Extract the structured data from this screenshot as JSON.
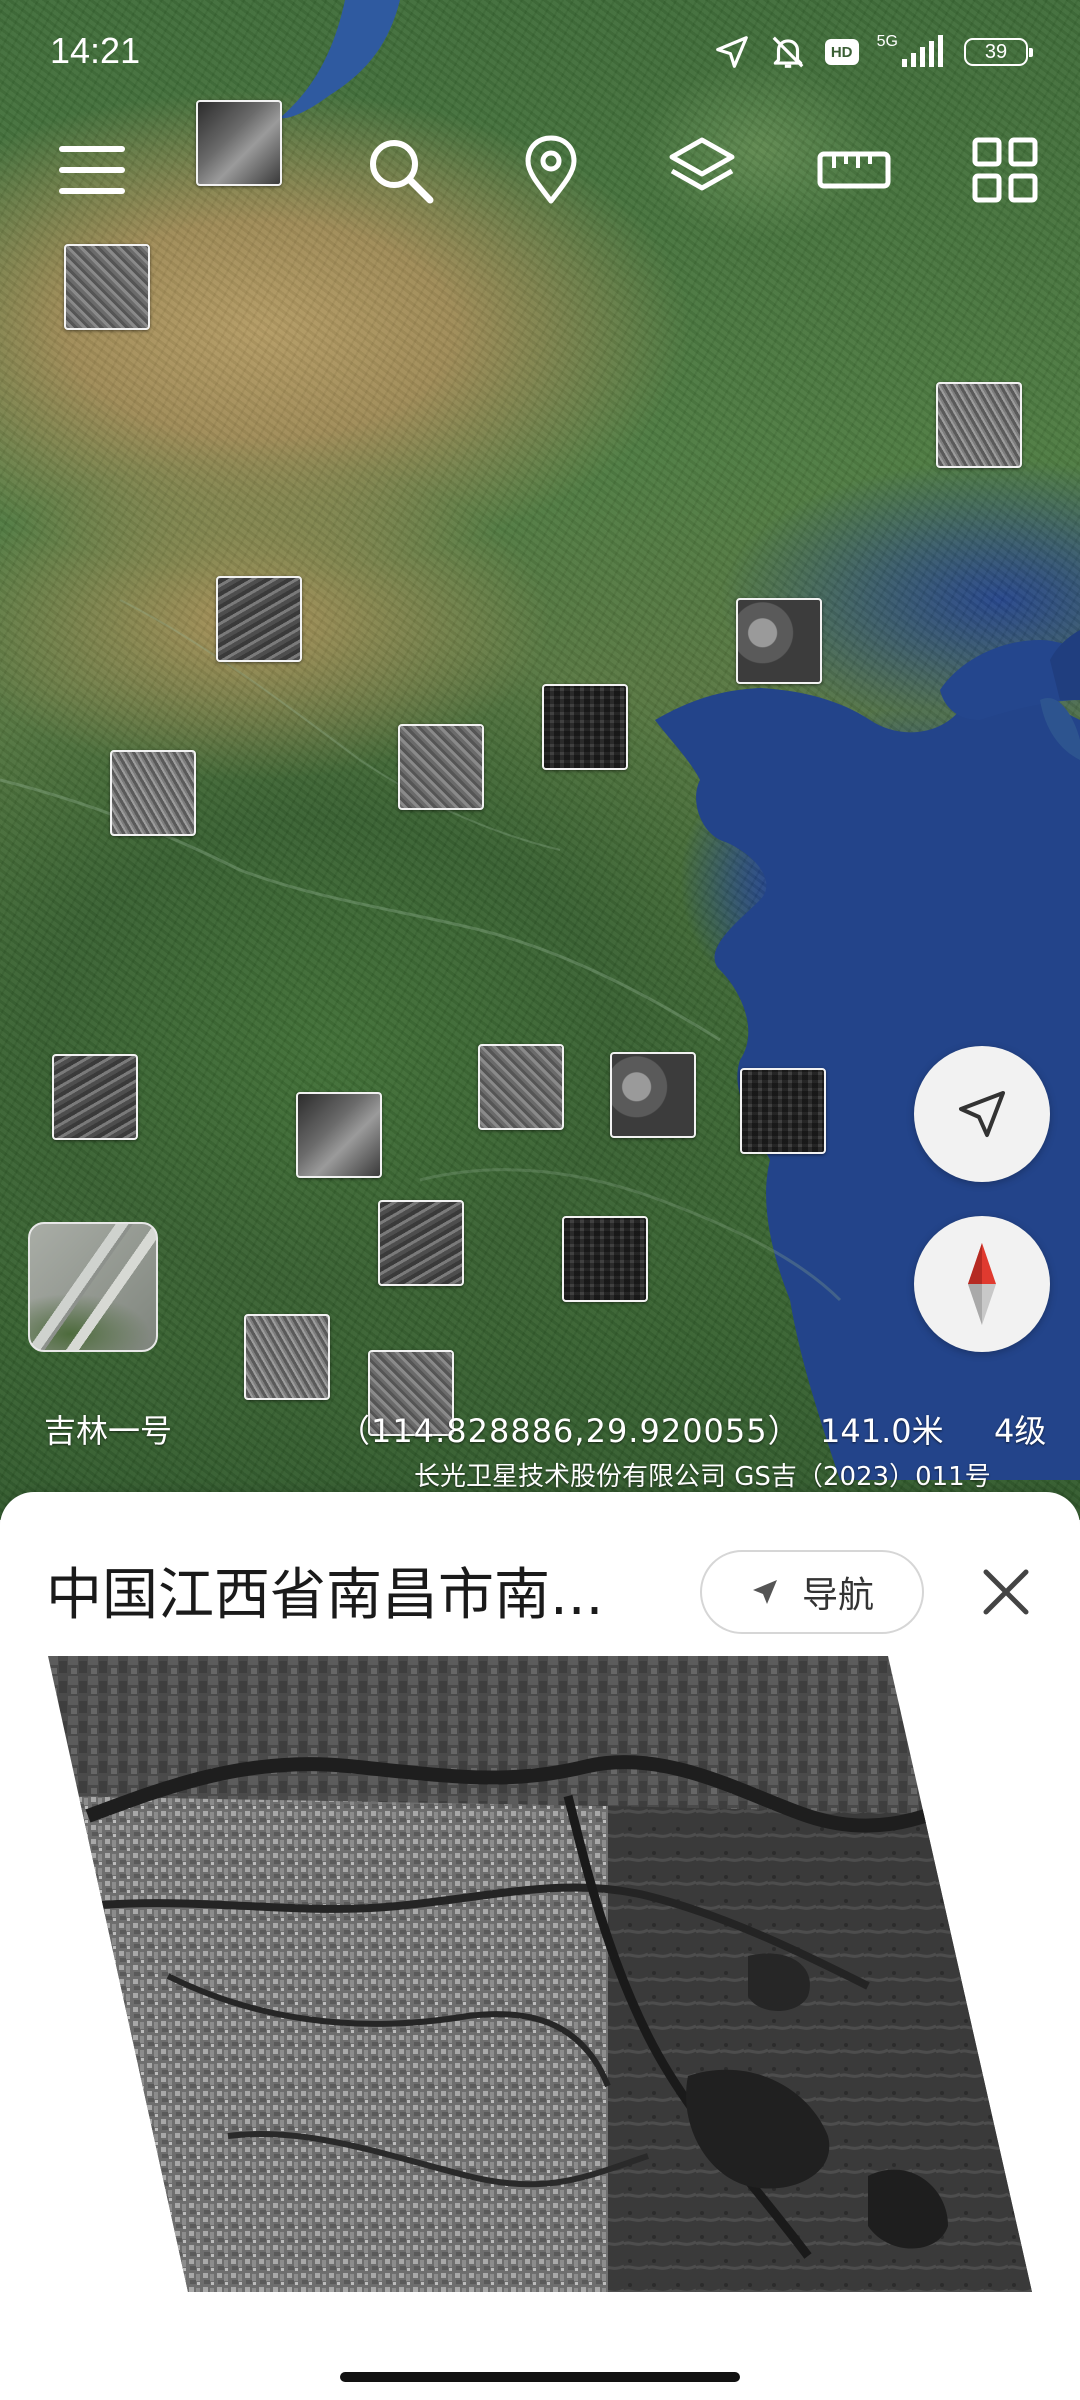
{
  "status_bar": {
    "time": "14:21",
    "hd_badge": "HD",
    "network": "5G",
    "battery": "39",
    "icons": [
      "location-arrow-icon",
      "bell-muted-icon",
      "hd-icon",
      "signal-icon",
      "battery-icon"
    ]
  },
  "toolbar": {
    "items": [
      {
        "name": "menu",
        "icon": "menu-icon"
      },
      {
        "name": "search",
        "icon": "search-icon"
      },
      {
        "name": "location",
        "icon": "map-pin-icon"
      },
      {
        "name": "layers",
        "icon": "layers-icon"
      },
      {
        "name": "ruler",
        "icon": "ruler-icon"
      },
      {
        "name": "apps",
        "icon": "grid-icon"
      }
    ]
  },
  "map": {
    "satellite_label": "吉林一号",
    "coordinates": "（114.828886,29.920055）",
    "scale": "141.0米",
    "zoom_level": "4级",
    "copyright": "长光卫星技术股份有限公司 GS吉（2023）011号",
    "thumbnail_count": 19
  },
  "fab": {
    "locate_icon": "navigation-arrow-icon",
    "compass_icon": "compass-icon",
    "compass_color": "#e03a2f"
  },
  "sheet": {
    "title": "中国江西省南昌市南...",
    "nav_label": "导航",
    "nav_icon": "navigation-arrow-icon",
    "close_icon": "close-icon"
  },
  "colors": {
    "sheet_background": "#ffffff",
    "fab_background": "#f2f2f2",
    "sea": "#23448a"
  }
}
